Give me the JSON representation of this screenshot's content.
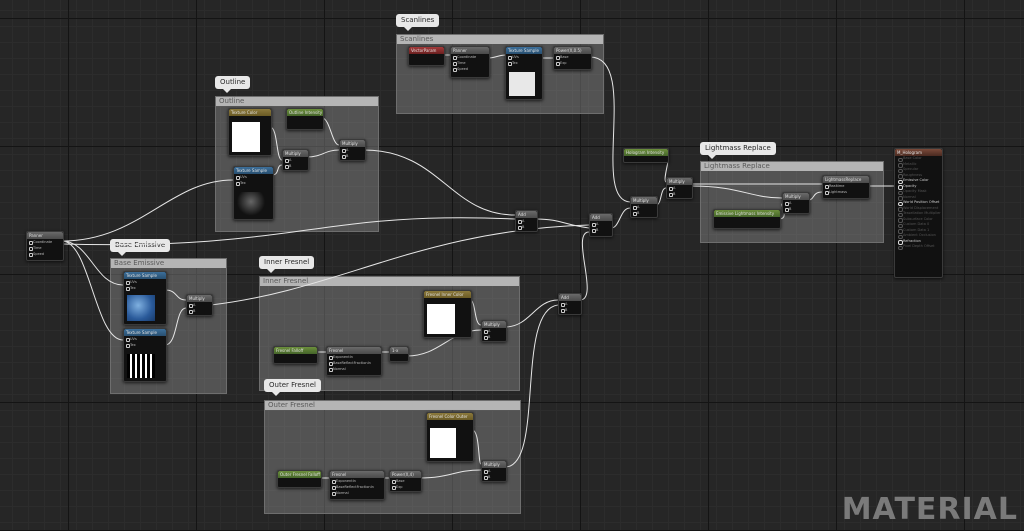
{
  "comments": {
    "scanlines": {
      "tag": "Scanlines",
      "header": "Scanlines"
    },
    "outline": {
      "tag": "Outline",
      "header": "Outline"
    },
    "base_emissive": {
      "tag": "Base Emissive",
      "header": "Base Emissive"
    },
    "inner_fresnel": {
      "tag": "Inner Fresnel",
      "header": "Inner Fresnel"
    },
    "outer_fresnel": {
      "tag": "Outer Fresnel",
      "header": "Outer Fresnel"
    },
    "lightmass_replace": {
      "tag": "Lightmass Replace",
      "header": "Lightmass Replace"
    }
  },
  "nodes": {
    "panner_main": {
      "title": "Panner",
      "pins": [
        "Coordinate",
        "Time",
        "Speed"
      ]
    },
    "scan_vector": {
      "title": "VectorParam"
    },
    "scan_panner": {
      "title": "Panner",
      "pins": [
        "Coordinate",
        "Time",
        "Speed"
      ]
    },
    "scan_texture": {
      "title": "Texture Sample",
      "pins": [
        "UVs",
        "Tex"
      ]
    },
    "scan_power": {
      "title": "Power(X,0.5)",
      "pins": [
        "Base",
        "Exp"
      ]
    },
    "outline_tex_param": {
      "title": "Texture Color"
    },
    "outline_intensity": {
      "title": "Outline Intensity"
    },
    "outline_multiply1": {
      "title": "Multiply",
      "pins": [
        "A",
        "B"
      ]
    },
    "outline_multiply2": {
      "title": "Multiply",
      "pins": [
        "A",
        "B"
      ]
    },
    "outline_texture": {
      "title": "Texture Sample",
      "pins": [
        "UVs",
        "Tex"
      ]
    },
    "base_texture1": {
      "title": "Texture Sample",
      "pins": [
        "UVs",
        "Tex"
      ]
    },
    "base_texture2": {
      "title": "Texture Sample",
      "pins": [
        "UVs",
        "Tex"
      ]
    },
    "base_multiply": {
      "title": "Multiply",
      "pins": [
        "A",
        "B"
      ]
    },
    "inner_color": {
      "title": "Fresnel Inner Color"
    },
    "inner_falloff": {
      "title": "Fresnel Falloff"
    },
    "inner_fresnel_node": {
      "title": "Fresnel",
      "pins": [
        "ExponentIn",
        "BaseReflectFractionIn",
        "Normal"
      ]
    },
    "inner_oneminus": {
      "title": "1-x"
    },
    "inner_multiply": {
      "title": "Multiply",
      "pins": [
        "A",
        "B"
      ]
    },
    "outer_color": {
      "title": "Fresnel Color Outer"
    },
    "outer_falloff": {
      "title": "Outer Fresnel Falloff"
    },
    "outer_fresnel_node": {
      "title": "Fresnel",
      "pins": [
        "ExponentIn",
        "BaseReflectFractionIn",
        "Normal"
      ]
    },
    "outer_power": {
      "title": "Power(X,4)",
      "pins": [
        "Base",
        "Exp"
      ]
    },
    "outer_multiply": {
      "title": "Multiply",
      "pins": [
        "A",
        "B"
      ]
    },
    "add1": {
      "title": "Add",
      "pins": [
        "A",
        "B"
      ]
    },
    "add2": {
      "title": "Add",
      "pins": [
        "A",
        "B"
      ]
    },
    "add3": {
      "title": "Add",
      "pins": [
        "A",
        "B"
      ]
    },
    "hologram_intensity": {
      "title": "Hologram Intensity"
    },
    "multiply_a": {
      "title": "Multiply",
      "pins": [
        "A",
        "B"
      ]
    },
    "multiply_b": {
      "title": "Multiply",
      "pins": [
        "A",
        "B"
      ]
    },
    "emissive_lightmass": {
      "title": "Emissive Lightmass Intensity"
    },
    "lm_multiply": {
      "title": "Multiply",
      "pins": [
        "A",
        "B"
      ]
    },
    "lightmass_replace_node": {
      "title": "LightmassReplace",
      "pins": [
        "Realtime",
        "Lightmass"
      ]
    }
  },
  "result": {
    "title": "M_Hologram",
    "pins": [
      {
        "label": "Base Color",
        "active": false
      },
      {
        "label": "Metallic",
        "active": false
      },
      {
        "label": "Specular",
        "active": false
      },
      {
        "label": "Roughness",
        "active": false
      },
      {
        "label": "Emissive Color",
        "active": true
      },
      {
        "label": "Opacity",
        "active": true
      },
      {
        "label": "Opacity Mask",
        "active": false
      },
      {
        "label": "Normal",
        "active": false
      },
      {
        "label": "World Position Offset",
        "active": true
      },
      {
        "label": "World Displacement",
        "active": false
      },
      {
        "label": "Tessellation Multiplier",
        "active": false
      },
      {
        "label": "Subsurface Color",
        "active": false
      },
      {
        "label": "Custom Data 0",
        "active": false
      },
      {
        "label": "Custom Data 1",
        "active": false
      },
      {
        "label": "Ambient Occlusion",
        "active": false
      },
      {
        "label": "Refraction",
        "active": true
      },
      {
        "label": "Pixel Depth Offset",
        "active": false
      }
    ]
  },
  "watermark": "MATERIAL",
  "colors": {
    "background": "#262626",
    "comment": "#8c8c8c",
    "wire": "#e8e8e8"
  }
}
